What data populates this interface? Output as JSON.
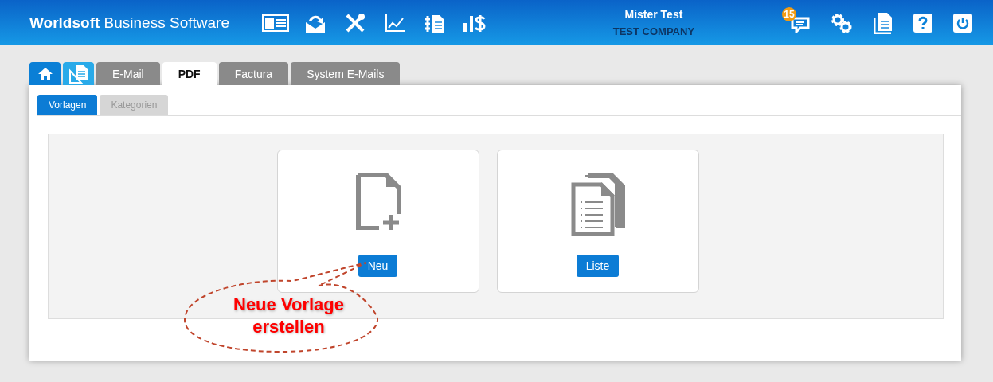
{
  "header": {
    "brand": "**Worldsoft** Business Software",
    "user_name": "Mister Test",
    "company": "TEST COMPANY",
    "notification_count": "15"
  },
  "tabs": [
    {
      "kind": "home",
      "color": "#0a7fd6",
      "selected": false
    },
    {
      "kind": "document",
      "color": "#29aae9",
      "selected": false
    },
    {
      "kind": "text",
      "label": "E-Mail",
      "selected": false
    },
    {
      "kind": "text",
      "label": "PDF",
      "selected": true
    },
    {
      "kind": "text",
      "label": "Factura",
      "selected": false
    },
    {
      "kind": "text",
      "label": "System E-Mails",
      "selected": false
    }
  ],
  "subtabs": [
    {
      "label": "Vorlagen",
      "selected": true
    },
    {
      "label": "Kategorien",
      "selected": false
    }
  ],
  "cards": [
    {
      "kind": "new",
      "button": "Neu"
    },
    {
      "kind": "list",
      "button": "Liste"
    }
  ],
  "callout": {
    "text": "Neue Vorlage erstellen"
  }
}
